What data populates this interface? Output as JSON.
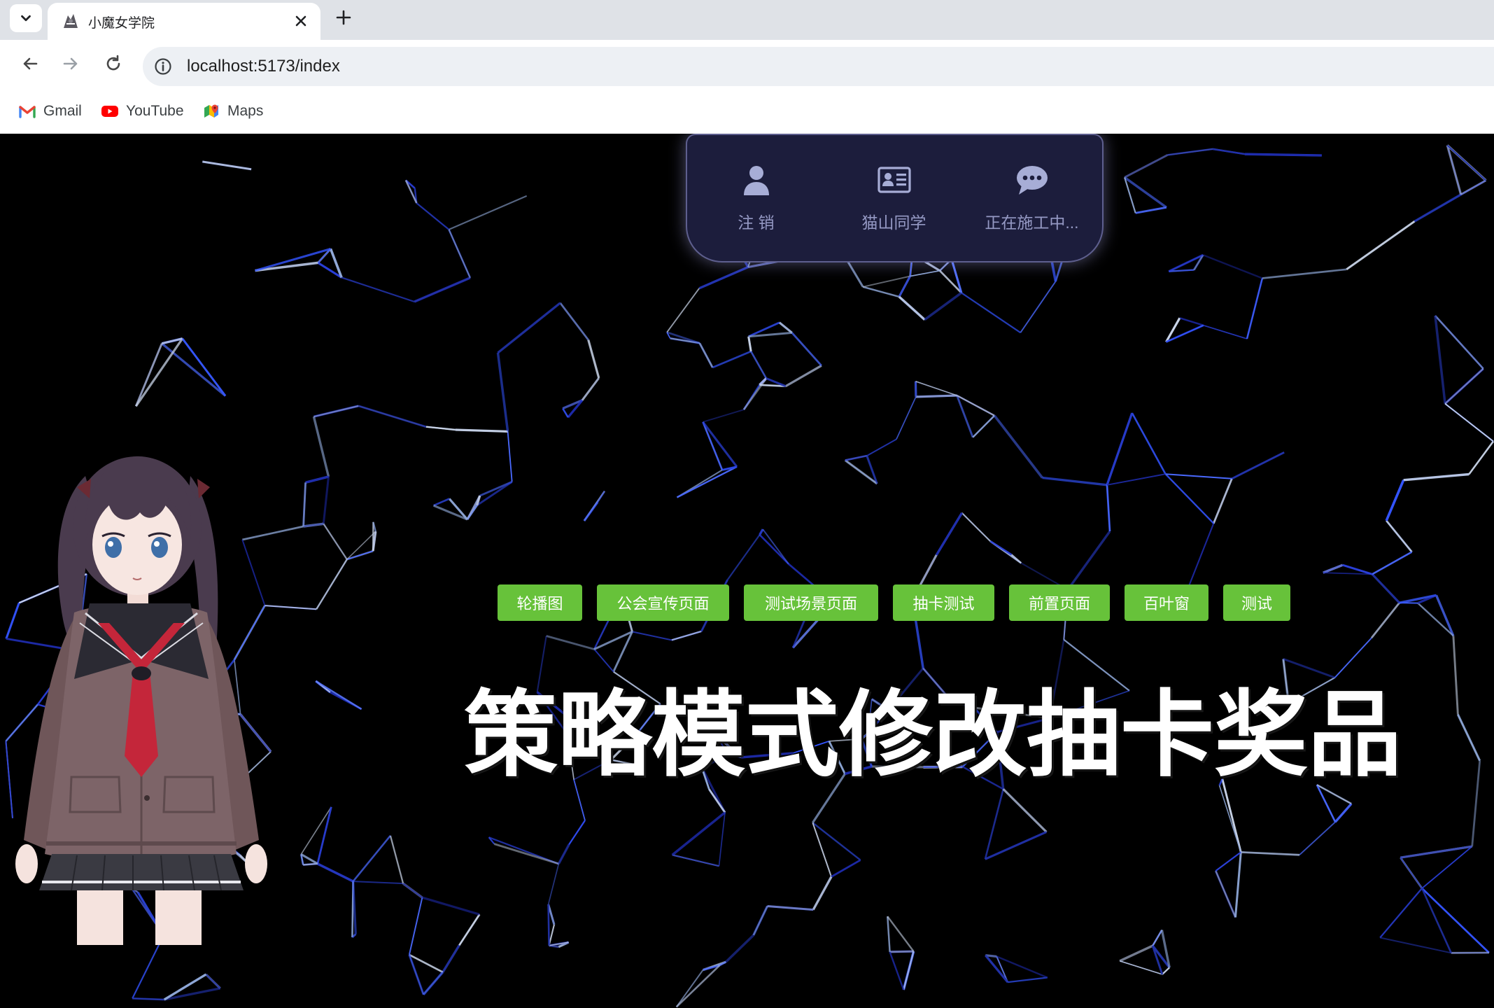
{
  "browser": {
    "tab_list_icon": "chevron-down-icon",
    "tab": {
      "favicon": "witch-favicon-icon",
      "title": "小魔女学院",
      "close_icon": "close-icon"
    },
    "new_tab_icon": "plus-icon",
    "toolbar": {
      "back_icon": "back-arrow-icon",
      "forward_icon": "forward-arrow-icon",
      "reload_icon": "reload-icon"
    },
    "address": {
      "info_icon": "info-icon",
      "url": "localhost:5173/index"
    },
    "bookmarks": [
      {
        "label": "Gmail",
        "icon": "gmail-icon"
      },
      {
        "label": "YouTube",
        "icon": "youtube-icon"
      },
      {
        "label": "Maps",
        "icon": "maps-icon"
      }
    ]
  },
  "nav_panel": {
    "items": [
      {
        "label": "注 销",
        "icon": "user-icon"
      },
      {
        "label": "猫山同学",
        "icon": "id-card-icon"
      },
      {
        "label": "正在施工中...",
        "icon": "chat-bubble-icon"
      }
    ]
  },
  "buttons": [
    "轮播图",
    "公会宣传页面",
    "测试场景页面",
    "抽卡测试",
    "前置页面",
    "百叶窗",
    "测试"
  ],
  "caption": "策略模式修改抽卡奖品",
  "colors": {
    "page_background": "#000000",
    "button_green": "#67c23a",
    "nav_panel_bg": "#1c1d3c",
    "nav_icon": "#a7add6",
    "particle_blue": "#3354ff"
  }
}
